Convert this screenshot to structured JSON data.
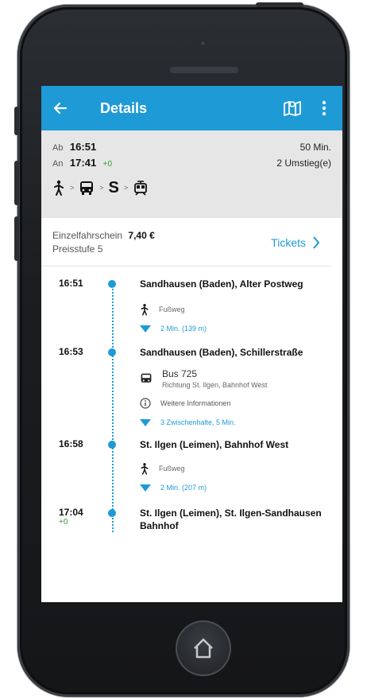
{
  "appbar": {
    "title": "Details"
  },
  "summary": {
    "dep_label": "Ab",
    "dep_time": "16:51",
    "arr_label": "An",
    "arr_time": "17:41",
    "arr_delay": "+0",
    "duration": "50 Min.",
    "transfers": "2 Umstieg(e)",
    "s_label": "S"
  },
  "ticket": {
    "name": "Einzelfahrschein",
    "price": "7,40 €",
    "zone": "Preisstufe 5",
    "link": "Tickets"
  },
  "itinerary": {
    "stop1": {
      "time": "16:51",
      "name": "Sandhausen (Baden), Alter Postweg"
    },
    "walk1": {
      "label": "Fußweg",
      "detail": "2 Min. (139 m)"
    },
    "stop2": {
      "time": "16:53",
      "name": "Sandhausen (Baden), Schillerstraße"
    },
    "bus": {
      "line": "Bus 725",
      "direction": "Richtung St. Ilgen, Bahnhof West",
      "info": "Weitere Informationen",
      "stops": "3 Zwischenhalte, 5 Min."
    },
    "stop3": {
      "time": "16:58",
      "name": "St. Ilgen (Leimen), Bahnhof West"
    },
    "walk2": {
      "label": "Fußweg",
      "detail": "2 Min. (207 m)"
    },
    "stop4": {
      "time": "17:04",
      "delay": "+0",
      "name": "St. Ilgen (Leimen), St. Ilgen-Sandhausen Bahnhof"
    }
  },
  "colors": {
    "primary": "#1e9ad6",
    "delay_green": "#2e9d2e",
    "summary_bg": "#e6e6e6"
  }
}
